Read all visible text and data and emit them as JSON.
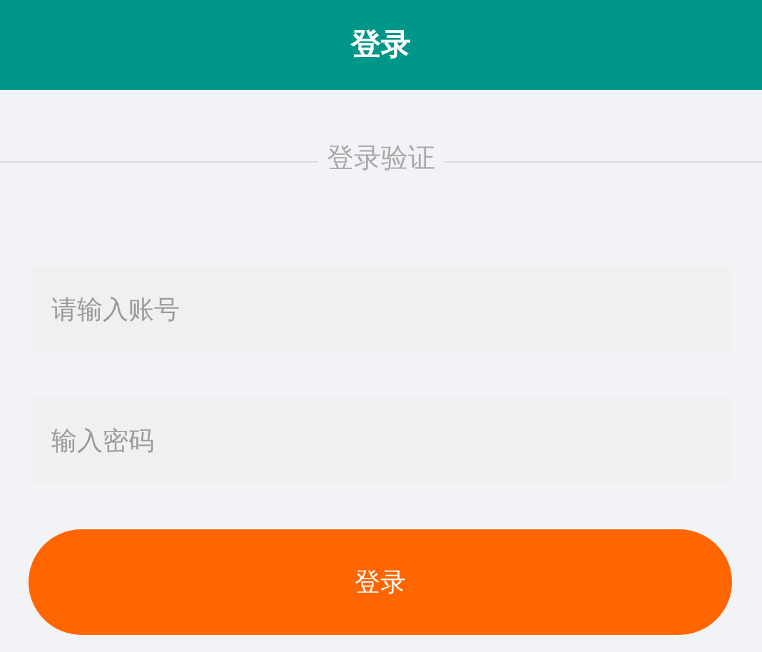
{
  "header": {
    "title": "登录"
  },
  "section": {
    "title": "登录验证"
  },
  "fields": [
    {
      "placeholder": "请输入账号"
    },
    {
      "placeholder": "输入密码"
    }
  ],
  "submit": {
    "label": "登录"
  }
}
